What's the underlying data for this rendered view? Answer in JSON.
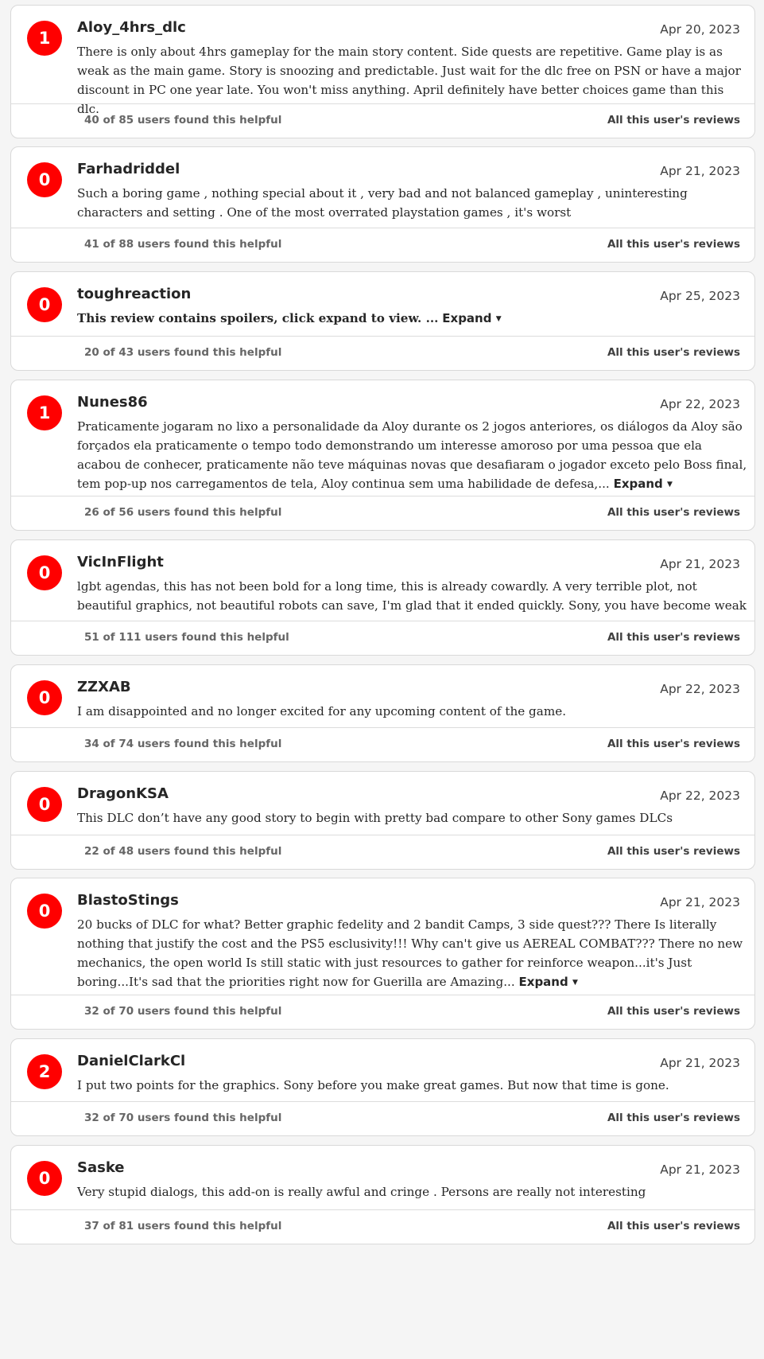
{
  "colors": {
    "score_badge_bg": "#ff0000",
    "score_badge_text": "#ffffff",
    "page_bg": "#f5f5f5",
    "card_bg": "#ffffff"
  },
  "labels": {
    "expand": "Expand",
    "expand_icon": "caret-down-icon",
    "all_reviews": "All this user's reviews"
  },
  "reviews": [
    {
      "score": "1",
      "user": "Aloy_4hrs_dlc",
      "date": "Apr 20, 2023",
      "text": "There is only about 4hrs gameplay for the main story content. Side quests are repetitive. Game play is as weak as the main game. Story is snoozing and predictable. Just wait for the dlc free on PSN or have a major discount in PC one year late. You won't miss anything. April definitely have better choices game than this dlc.",
      "helpful": "40 of 85 users found this helpful"
    },
    {
      "score": "0",
      "user": "Farhadriddel",
      "date": "Apr 21, 2023",
      "text": "Such a boring game , nothing special about it , very bad and not balanced gameplay , uninteresting characters and setting . One of the most overrated playstation games , it's worst",
      "helpful": "41 of 88 users found this helpful"
    },
    {
      "score": "0",
      "user": "toughreaction",
      "date": "Apr 25, 2023",
      "text": "This review contains spoilers, click expand to view. ...",
      "helpful": "20 of 43 users found this helpful"
    },
    {
      "score": "1",
      "user": "Nunes86",
      "date": "Apr 22, 2023",
      "text": "Praticamente jogaram no lixo a personalidade da Aloy durante os 2 jogos anteriores, os diálogos da Aloy são forçados ela praticamente o tempo todo demonstrando um interesse amoroso por uma pessoa que ela acabou de conhecer, praticamente não teve máquinas novas que desafiaram o jogador exceto pelo Boss final, tem pop-up nos carregamentos de tela, Aloy continua sem uma habilidade de defesa,...",
      "helpful": "26 of 56 users found this helpful"
    },
    {
      "score": "0",
      "user": "VicInFlight",
      "date": "Apr 21, 2023",
      "text": "lgbt agendas, this has not been bold for a long time, this is already cowardly. A very terrible plot, not beautiful graphics, not beautiful robots can save, I'm glad that it ended quickly. Sony, you have become weak",
      "helpful": "51 of 111 users found this helpful"
    },
    {
      "score": "0",
      "user": "ZZXAB",
      "date": "Apr 22, 2023",
      "text": "I am disappointed and no longer excited for any upcoming content of the game.",
      "helpful": "34 of 74 users found this helpful"
    },
    {
      "score": "0",
      "user": "DragonKSA",
      "date": "Apr 22, 2023",
      "text": "This DLC don’t have any good story to begin with pretty bad compare to other Sony games DLCs",
      "helpful": "22 of 48 users found this helpful"
    },
    {
      "score": "0",
      "user": "BlastoStings",
      "date": "Apr 21, 2023",
      "text": "20 bucks of DLC for what? Better graphic fedelity and 2 bandit Camps, 3 side quest??? There Is literally nothing that justify the cost and the PS5 esclusivity!!! Why can't give us AEREAL COMBAT??? There no new mechanics, the open world Is still static with just resources to gather for reinforce weapon...it's Just boring...It's sad that the priorities right now for Guerilla are Amazing...",
      "helpful": "32 of 70 users found this helpful"
    },
    {
      "score": "2",
      "user": "DanielClarkCl",
      "date": "Apr 21, 2023",
      "text": "I put two points for the graphics. Sony before you make great games. But now that time is gone.",
      "helpful": "32 of 70 users found this helpful"
    },
    {
      "score": "0",
      "user": "Saske",
      "date": "Apr 21, 2023",
      "text": "Very stupid dialogs, this add-on is really awful and cringe . Persons are really not interesting",
      "helpful": "37 of 81 users found this helpful"
    }
  ]
}
